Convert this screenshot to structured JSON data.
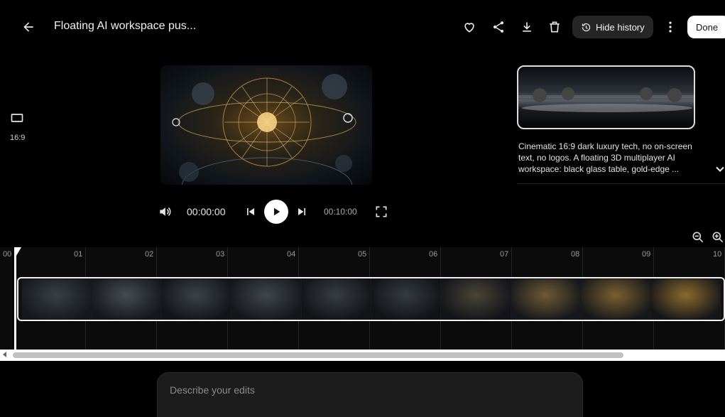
{
  "header": {
    "title": "Floating AI workspace pus...",
    "hide_history_label": "Hide history",
    "done_label": "Done",
    "icons": [
      "back-arrow-icon",
      "heart-icon",
      "share-icon",
      "download-icon",
      "trash-icon",
      "history-icon",
      "more-vert-icon"
    ]
  },
  "aspect": {
    "label": "16:9",
    "icon": "aspect-ratio-icon"
  },
  "player": {
    "current_time": "00:00:00",
    "duration": "00:10:00",
    "icons": [
      "volume-icon",
      "skip-previous-icon",
      "play-icon",
      "skip-next-icon",
      "fullscreen-icon"
    ]
  },
  "history": {
    "prompt_text": "Cinematic 16:9 dark luxury tech, no on-screen text, no logos. A floating 3D multiplayer AI workspace: black glass table, gold-edge ..."
  },
  "timeline": {
    "ticks": [
      "00",
      "01",
      "02",
      "03",
      "04",
      "05",
      "06",
      "07",
      "08",
      "09",
      "10"
    ],
    "playhead_seconds": 0,
    "zoom_icons": [
      "zoom-out-icon",
      "zoom-in-icon"
    ]
  },
  "edit_prompt": {
    "placeholder": "Describe your edits"
  },
  "colors": {
    "background": "#000000",
    "accent": "#ffffff",
    "pill": "#262626"
  }
}
